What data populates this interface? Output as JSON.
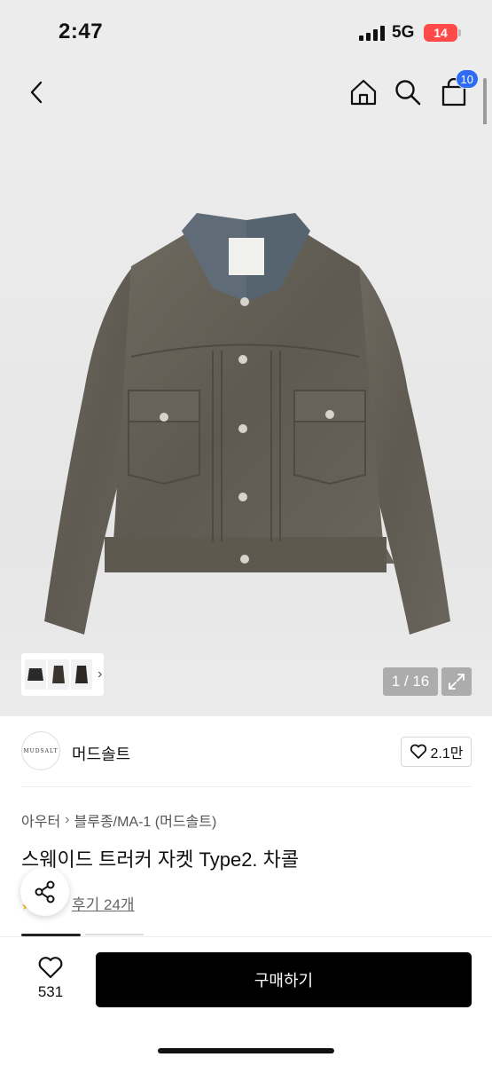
{
  "status_bar": {
    "time": "2:47",
    "network": "5G",
    "battery": "14"
  },
  "header": {
    "back_icon": "chevron-left-icon",
    "home_icon": "home-icon",
    "search_icon": "search-icon",
    "cart_icon": "shopping-bag-icon",
    "cart_count": "10"
  },
  "gallery": {
    "counter": "1 / 16",
    "expand_icon": "expand-icon"
  },
  "brand": {
    "logo_text": "MUDSALT",
    "name": "머드솔트",
    "likes": "2.1만"
  },
  "breadcrumb": [
    "아우터",
    "블루종/MA-1 (머드솔트)"
  ],
  "product": {
    "title": "스웨이드 트러커 자켓 Type2. 차콜",
    "reviews": "후기 24개"
  },
  "bottom_bar": {
    "wish_count": "531",
    "buy_label": "구매하기"
  },
  "colors": {
    "accent_blue": "#2f6cf6",
    "battery_red": "#ff4a4a",
    "buy_button": "#000000"
  }
}
